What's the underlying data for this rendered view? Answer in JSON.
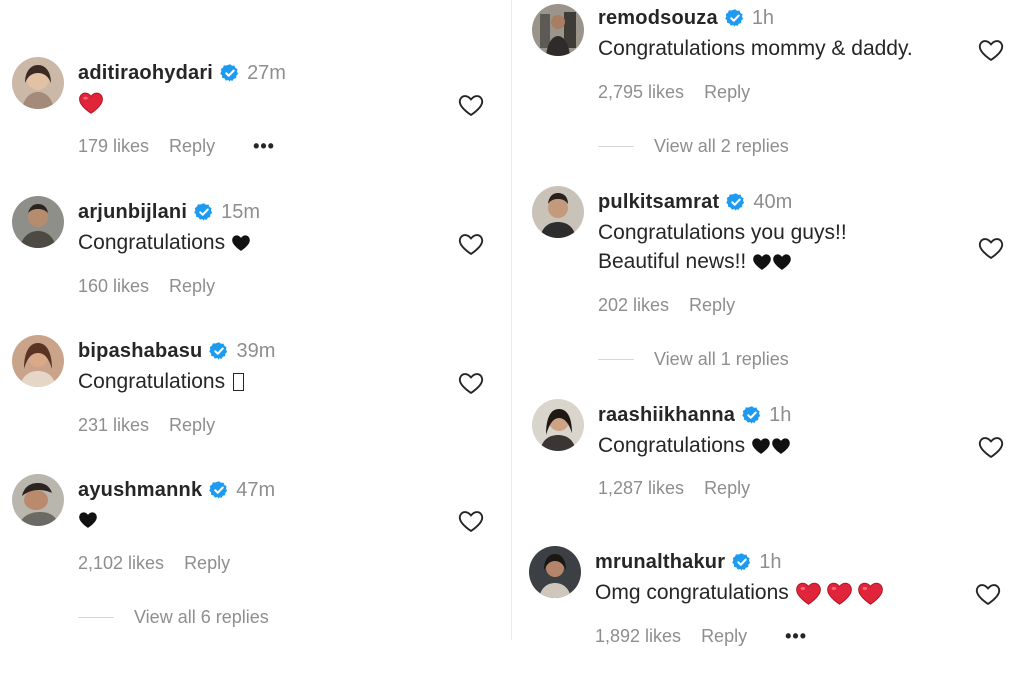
{
  "colors": {
    "verified": "#1d9bf0",
    "heart_red": "#e0243a",
    "heart_black": "#111111",
    "muted": "#8e8e8e"
  },
  "left_comments": [
    {
      "username": "aditiraohydari",
      "time": "27m",
      "text": "",
      "likes": "179 likes",
      "reply": "Reply",
      "more": "•••",
      "emoji": "red-heart"
    },
    {
      "username": "arjunbijlani",
      "time": "15m",
      "text": "Congratulations ",
      "likes": "160 likes",
      "reply": "Reply",
      "emoji": "black-heart"
    },
    {
      "username": "bipashabasu",
      "time": "39m",
      "text": "Congratulations ",
      "likes": "231 likes",
      "reply": "Reply",
      "emoji": "missing-glyph"
    },
    {
      "username": "ayushmannk",
      "time": "47m",
      "text": "",
      "likes": "2,102 likes",
      "reply": "Reply",
      "emoji": "black-heart",
      "view_replies": "View all 6 replies"
    }
  ],
  "right_comments": [
    {
      "username": "remodsouza",
      "time": "1h",
      "text": "Congratulations mommy & daddy.",
      "likes": "2,795 likes",
      "reply": "Reply",
      "view_replies": "View all 2 replies"
    },
    {
      "username": "pulkitsamrat",
      "time": "40m",
      "text_line1": "Congratulations you guys!!",
      "text_line2": "Beautiful news!! ",
      "likes": "202 likes",
      "reply": "Reply",
      "emoji": "black-heart x2",
      "view_replies": "View all 1 replies"
    },
    {
      "username": "raashiikhanna",
      "time": "1h",
      "text": "Congratulations ",
      "likes": "1,287 likes",
      "reply": "Reply",
      "emoji": "black-heart x2"
    },
    {
      "username": "mrunalthakur",
      "time": "1h",
      "text": "Omg congratulations ",
      "likes": "1,892 likes",
      "reply": "Reply",
      "more": "•••",
      "emoji": "red-heart x3"
    }
  ]
}
